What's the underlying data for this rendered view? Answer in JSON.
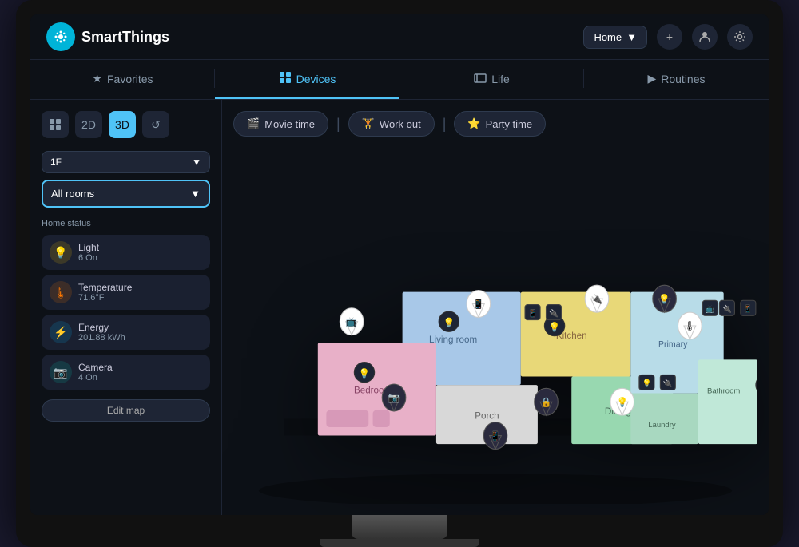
{
  "app": {
    "name": "SmartThings"
  },
  "header": {
    "home_selector": "Home",
    "add_label": "+",
    "profile_label": "👤",
    "settings_label": "⚙"
  },
  "nav": {
    "tabs": [
      {
        "id": "favorites",
        "label": "Favorites",
        "icon": "★",
        "active": false
      },
      {
        "id": "devices",
        "label": "Devices",
        "icon": "▦",
        "active": true
      },
      {
        "id": "life",
        "label": "Life",
        "icon": "☰",
        "active": false
      },
      {
        "id": "routines",
        "label": "Routines",
        "icon": "▶",
        "active": false
      }
    ]
  },
  "sidebar": {
    "view_controls": [
      {
        "id": "grid",
        "label": "⊞",
        "active": false
      },
      {
        "id": "2d",
        "label": "2D",
        "active": false
      },
      {
        "id": "3d",
        "label": "3D",
        "active": true
      },
      {
        "id": "history",
        "label": "↺",
        "active": false
      }
    ],
    "floor_selector": {
      "value": "1F",
      "icon": "▼"
    },
    "room_selector": {
      "value": "All rooms",
      "icon": "▼"
    },
    "home_status_title": "Home status",
    "status_items": [
      {
        "id": "light",
        "icon": "💡",
        "icon_type": "yellow",
        "label": "Light",
        "value": "6 On"
      },
      {
        "id": "temperature",
        "icon": "🌡",
        "icon_type": "orange",
        "label": "Temperature",
        "value": "71.6°F"
      },
      {
        "id": "energy",
        "icon": "⚡",
        "icon_type": "blue",
        "label": "Energy",
        "value": "201.88 kWh"
      },
      {
        "id": "camera",
        "icon": "📷",
        "icon_type": "teal",
        "label": "Camera",
        "value": "4 On"
      }
    ],
    "edit_map_label": "Edit map"
  },
  "scenes": [
    {
      "id": "movie",
      "icon": "🎬",
      "label": "Movie time"
    },
    {
      "id": "workout",
      "icon": "🏋",
      "label": "Work out"
    },
    {
      "id": "party",
      "icon": "⭐",
      "label": "Party time"
    }
  ],
  "floor_plan": {
    "rooms": [
      {
        "id": "living_room",
        "label": "Living room",
        "color": "#b8d4f0"
      },
      {
        "id": "kitchen",
        "label": "Kitchen",
        "color": "#f5e6a0"
      },
      {
        "id": "bedroom",
        "label": "Bedroom",
        "color": "#f0c0d0"
      },
      {
        "id": "dining",
        "label": "Dining",
        "color": "#b8e8d0"
      },
      {
        "id": "porch",
        "label": "Porch",
        "color": "#e8e8e8"
      },
      {
        "id": "primary",
        "label": "Primary",
        "color": "#d4eaf0"
      },
      {
        "id": "laundry",
        "label": "Laundry",
        "color": "#c8e8d8"
      },
      {
        "id": "bathroom",
        "label": "Bathroom",
        "color": "#e0f0e8"
      }
    ]
  }
}
